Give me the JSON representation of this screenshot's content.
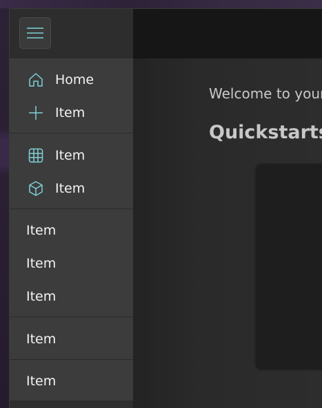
{
  "colors": {
    "accent": "#7fd1d8",
    "nav_bg": "#3c3c3c",
    "content_bg": "#2b2b2b",
    "text": "#f2f2f2"
  },
  "nav": {
    "menu_button_icon": "hamburger-menu-icon",
    "items": [
      {
        "label": "Home",
        "icon": "home-icon"
      },
      {
        "label": "Item",
        "icon": "plus-icon"
      },
      {
        "label": "Item",
        "icon": "grid-icon"
      },
      {
        "label": "Item",
        "icon": "cube-icon"
      },
      {
        "label": "Item"
      },
      {
        "label": "Item"
      },
      {
        "label": "Item"
      },
      {
        "label": "Item"
      },
      {
        "label": "Item"
      }
    ]
  },
  "main": {
    "welcome_text": "Welcome to your",
    "section_title": "Quickstarts"
  }
}
